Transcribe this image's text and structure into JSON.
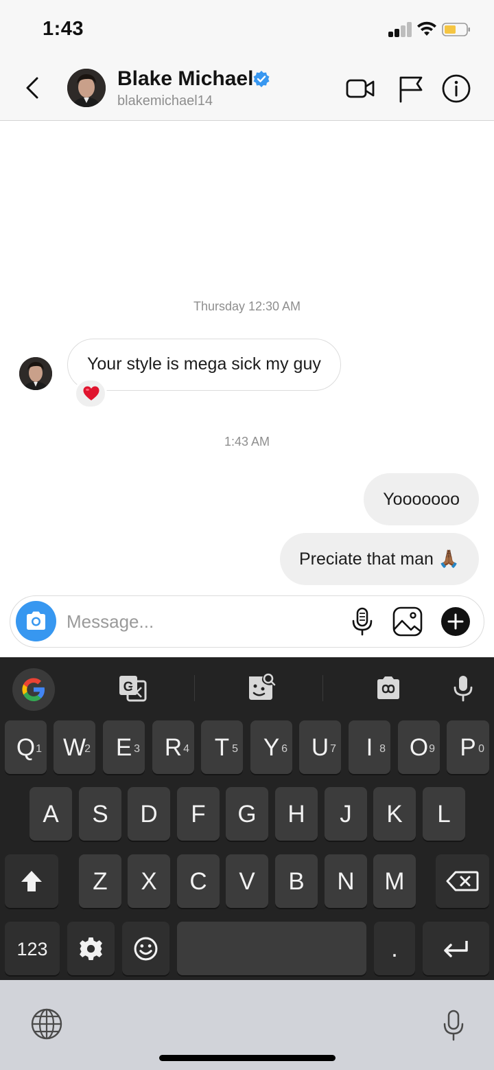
{
  "status_bar": {
    "time": "1:43"
  },
  "header": {
    "name": "Blake Michael",
    "username": "blakemichael14",
    "verified": true,
    "icons": [
      "back-icon",
      "video-call-icon",
      "flag-icon",
      "info-icon"
    ]
  },
  "chat": {
    "timestamp_1": "Thursday 12:30 AM",
    "incoming_message": "Your style is mega sick my guy",
    "reaction": "❤️",
    "timestamp_2": "1:43 AM",
    "outgoing_1": "Yooooooo",
    "outgoing_2": "Preciate that man 🙏🏾"
  },
  "composer": {
    "placeholder": "Message...",
    "icons": [
      "camera-icon",
      "microphone-icon",
      "gallery-icon",
      "plus-icon"
    ]
  },
  "keyboard": {
    "toolbar_icons": [
      "google-icon",
      "translate-icon",
      "sticker-icon",
      "gif-icon",
      "voice-icon"
    ],
    "row1": [
      "Q",
      "W",
      "E",
      "R",
      "T",
      "Y",
      "U",
      "I",
      "O",
      "P"
    ],
    "row1_hints": [
      "1",
      "2",
      "3",
      "4",
      "5",
      "6",
      "7",
      "8",
      "9",
      "0"
    ],
    "row2": [
      "A",
      "S",
      "D",
      "F",
      "G",
      "H",
      "J",
      "K",
      "L"
    ],
    "row3": [
      "Z",
      "X",
      "C",
      "V",
      "B",
      "N",
      "M"
    ],
    "numbers_key": "123",
    "period_key": "."
  },
  "colors": {
    "accent_blue": "#3797f0",
    "keyboard_bg": "#232323",
    "key_bg": "#3c3c3c",
    "bubble_out_bg": "#efefef"
  }
}
